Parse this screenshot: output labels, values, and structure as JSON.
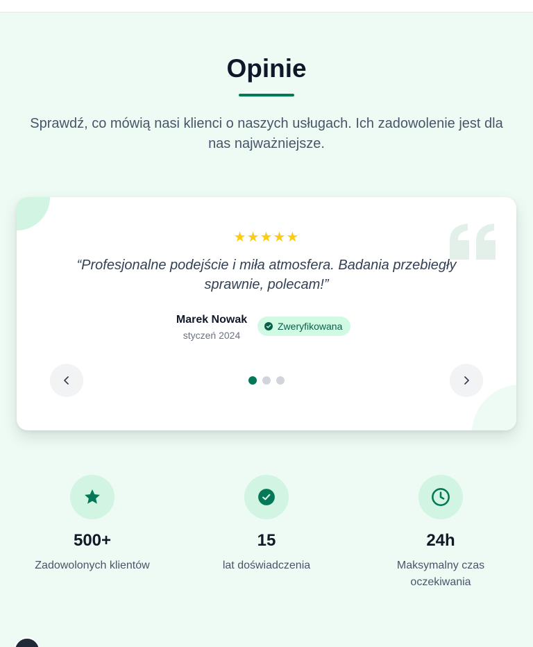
{
  "section": {
    "title": "Opinie",
    "subtitle": "Sprawdź, co mówią nasi klienci o naszych usługach. Ich zadowolenie jest dla nas najważniejsze."
  },
  "testimonial": {
    "rating": 5,
    "stars": "★★★★★",
    "quote": "“Profesjonalne podejście i miła atmosfera. Badania przebiegły sprawnie, polecam!”",
    "author": "Marek Nowak",
    "date": "styczeń 2024",
    "badge": "Zweryfikowana",
    "current_slide": 1,
    "total_slides": 3
  },
  "stats": [
    {
      "icon": "star-icon",
      "value": "500+",
      "label": "Zadowolonych klientów"
    },
    {
      "icon": "badge-check-icon",
      "value": "15",
      "label": "lat doświadczenia"
    },
    {
      "icon": "clock-icon",
      "value": "24h",
      "label": "Maksymalny czas oczekiwania"
    }
  ],
  "colors": {
    "background": "#eefbf4",
    "accent": "#047857",
    "star": "#facc15",
    "badge_bg": "#d1fae5",
    "icon_circle": "#d1f5e2"
  }
}
